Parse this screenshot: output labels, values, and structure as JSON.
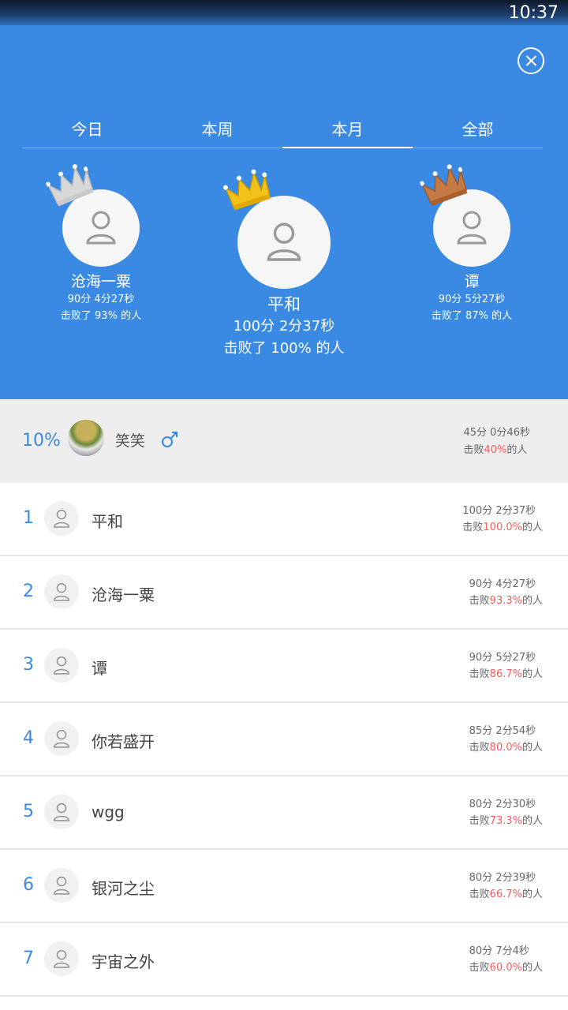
{
  "status_bar": {
    "time": "10:37"
  },
  "tabs": [
    {
      "label": "今日",
      "active": false
    },
    {
      "label": "本周",
      "active": false
    },
    {
      "label": "本月",
      "active": true
    },
    {
      "label": "全部",
      "active": false
    }
  ],
  "podium": {
    "first": {
      "name": "平和",
      "score": "100分 2分37秒",
      "beat": "击败了 100% 的人",
      "crown": "gold-crown"
    },
    "second": {
      "name": "沧海一粟",
      "score": "90分 4分27秒",
      "beat": "击败了 93% 的人",
      "crown": "silver-crown"
    },
    "third": {
      "name": "谭",
      "score": "90分 5分27秒",
      "beat": "击败了 87% 的人",
      "crown": "bronze-crown"
    }
  },
  "me": {
    "rank": "10%",
    "name": "笑笑",
    "gender_icon": "male-icon",
    "score": "45分 0分46秒",
    "beat_prefix": "击败",
    "beat_value": "40%",
    "beat_suffix": "的人"
  },
  "list": [
    {
      "rank": "1",
      "name": "平和",
      "score": "100分 2分37秒",
      "beat_prefix": "击败",
      "beat_value": "100.0%",
      "beat_suffix": "的人"
    },
    {
      "rank": "2",
      "name": "沧海一粟",
      "score": "90分 4分27秒",
      "beat_prefix": "击败",
      "beat_value": "93.3%",
      "beat_suffix": "的人"
    },
    {
      "rank": "3",
      "name": "谭",
      "score": "90分 5分27秒",
      "beat_prefix": "击败",
      "beat_value": "86.7%",
      "beat_suffix": "的人"
    },
    {
      "rank": "4",
      "name": "你若盛开",
      "score": "85分 2分54秒",
      "beat_prefix": "击败",
      "beat_value": "80.0%",
      "beat_suffix": "的人"
    },
    {
      "rank": "5",
      "name": "wgg",
      "score": "80分 2分30秒",
      "beat_prefix": "击败",
      "beat_value": "73.3%",
      "beat_suffix": "的人"
    },
    {
      "rank": "6",
      "name": "银河之尘",
      "score": "80分 2分39秒",
      "beat_prefix": "击败",
      "beat_value": "66.7%",
      "beat_suffix": "的人"
    },
    {
      "rank": "7",
      "name": "宇宙之外",
      "score": "80分 7分4秒",
      "beat_prefix": "击败",
      "beat_value": "60.0%",
      "beat_suffix": "的人"
    }
  ],
  "colors": {
    "header_blue": "#3a8ae4",
    "highlight_red": "#ff5a5a",
    "gold": "#f2c21a",
    "silver": "#d8d8d8",
    "bronze": "#c57a45"
  }
}
